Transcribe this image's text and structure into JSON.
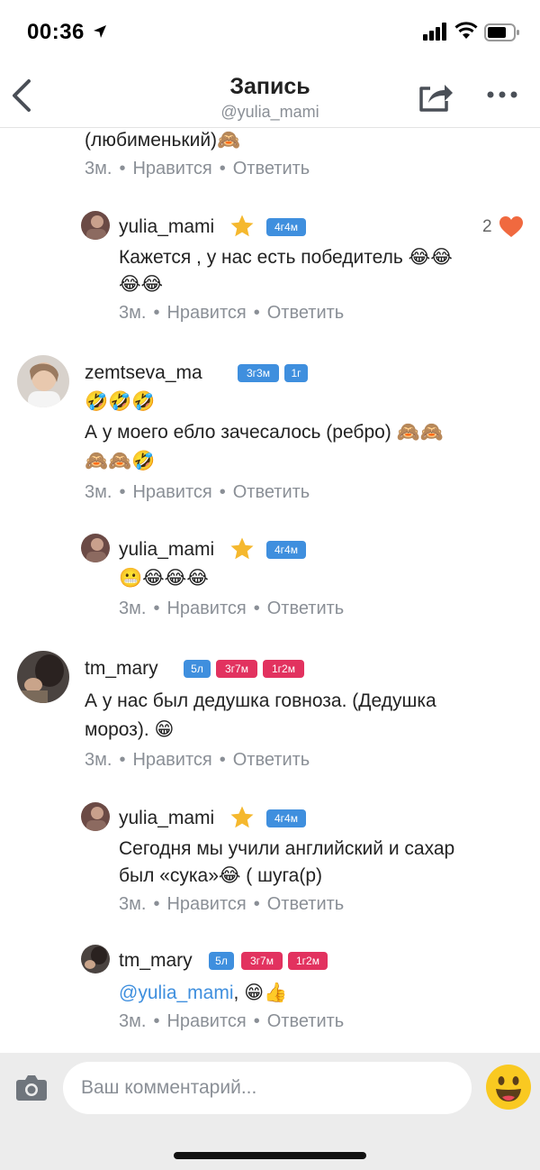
{
  "status": {
    "time": "00:36"
  },
  "nav": {
    "title": "Запись",
    "subtitle": "@yulia_mami"
  },
  "feed": {
    "c0": {
      "text": "(любименький)🙈",
      "time": "3м.",
      "like": "Нравится",
      "reply": "Ответить"
    },
    "c1": {
      "user": "yulia_mami",
      "badge1": "4г4м",
      "line1": "Кажется , у нас есть победитель 😂😂",
      "line2": "😂😂",
      "likes": "2",
      "time": "3м.",
      "like": "Нравится",
      "reply": "Ответить"
    },
    "c2": {
      "user": "zemtseva_ma",
      "badge1": "3г3м",
      "badge2": "1г",
      "line1": "🤣🤣🤣",
      "line2": "А у моего ебло зачесалось (ребро) 🙈🙈",
      "line3": "🙈🙈🤣",
      "time": "3м.",
      "like": "Нравится",
      "reply": "Ответить"
    },
    "c3": {
      "user": "yulia_mami",
      "badge1": "4г4м",
      "line1": "😬😂😂😂",
      "time": "3м.",
      "like": "Нравится",
      "reply": "Ответить"
    },
    "c4": {
      "user": "tm_mary",
      "badge1": "5л",
      "badge2": "3г7м",
      "badge3": "1г2м",
      "line1": "А у нас был дедушка говноза. (Дедушка",
      "line2": "мороз). 😁",
      "time": "3м.",
      "like": "Нравится",
      "reply": "Ответить"
    },
    "c5": {
      "user": "yulia_mami",
      "badge1": "4г4м",
      "line1": "Сегодня мы учили английский и сахар",
      "line2": "был «сука»😂 ( шуга(р)",
      "time": "3м.",
      "like": "Нравится",
      "reply": "Ответить"
    },
    "c6": {
      "user": "tm_mary",
      "badge1": "5л",
      "badge2": "3г7м",
      "badge3": "1г2м",
      "mention": "@yulia_mami",
      "rest": ", 😁👍",
      "time": "3м.",
      "like": "Нравится",
      "reply": "Ответить"
    }
  },
  "input": {
    "placeholder": "Ваш комментарий..."
  },
  "icons": [
    "location-arrow-icon",
    "signal-icon",
    "wifi-icon",
    "battery-icon",
    "back-chevron-icon",
    "share-icon",
    "more-dots-icon",
    "star-icon",
    "heart-icon",
    "camera-icon",
    "emoji-icon"
  ],
  "colors": {
    "accent": "#3f8fde",
    "badge_red": "#e2325f",
    "heart": "#f0693f",
    "star": "#f5b82e",
    "meta": "#8a8f96"
  }
}
